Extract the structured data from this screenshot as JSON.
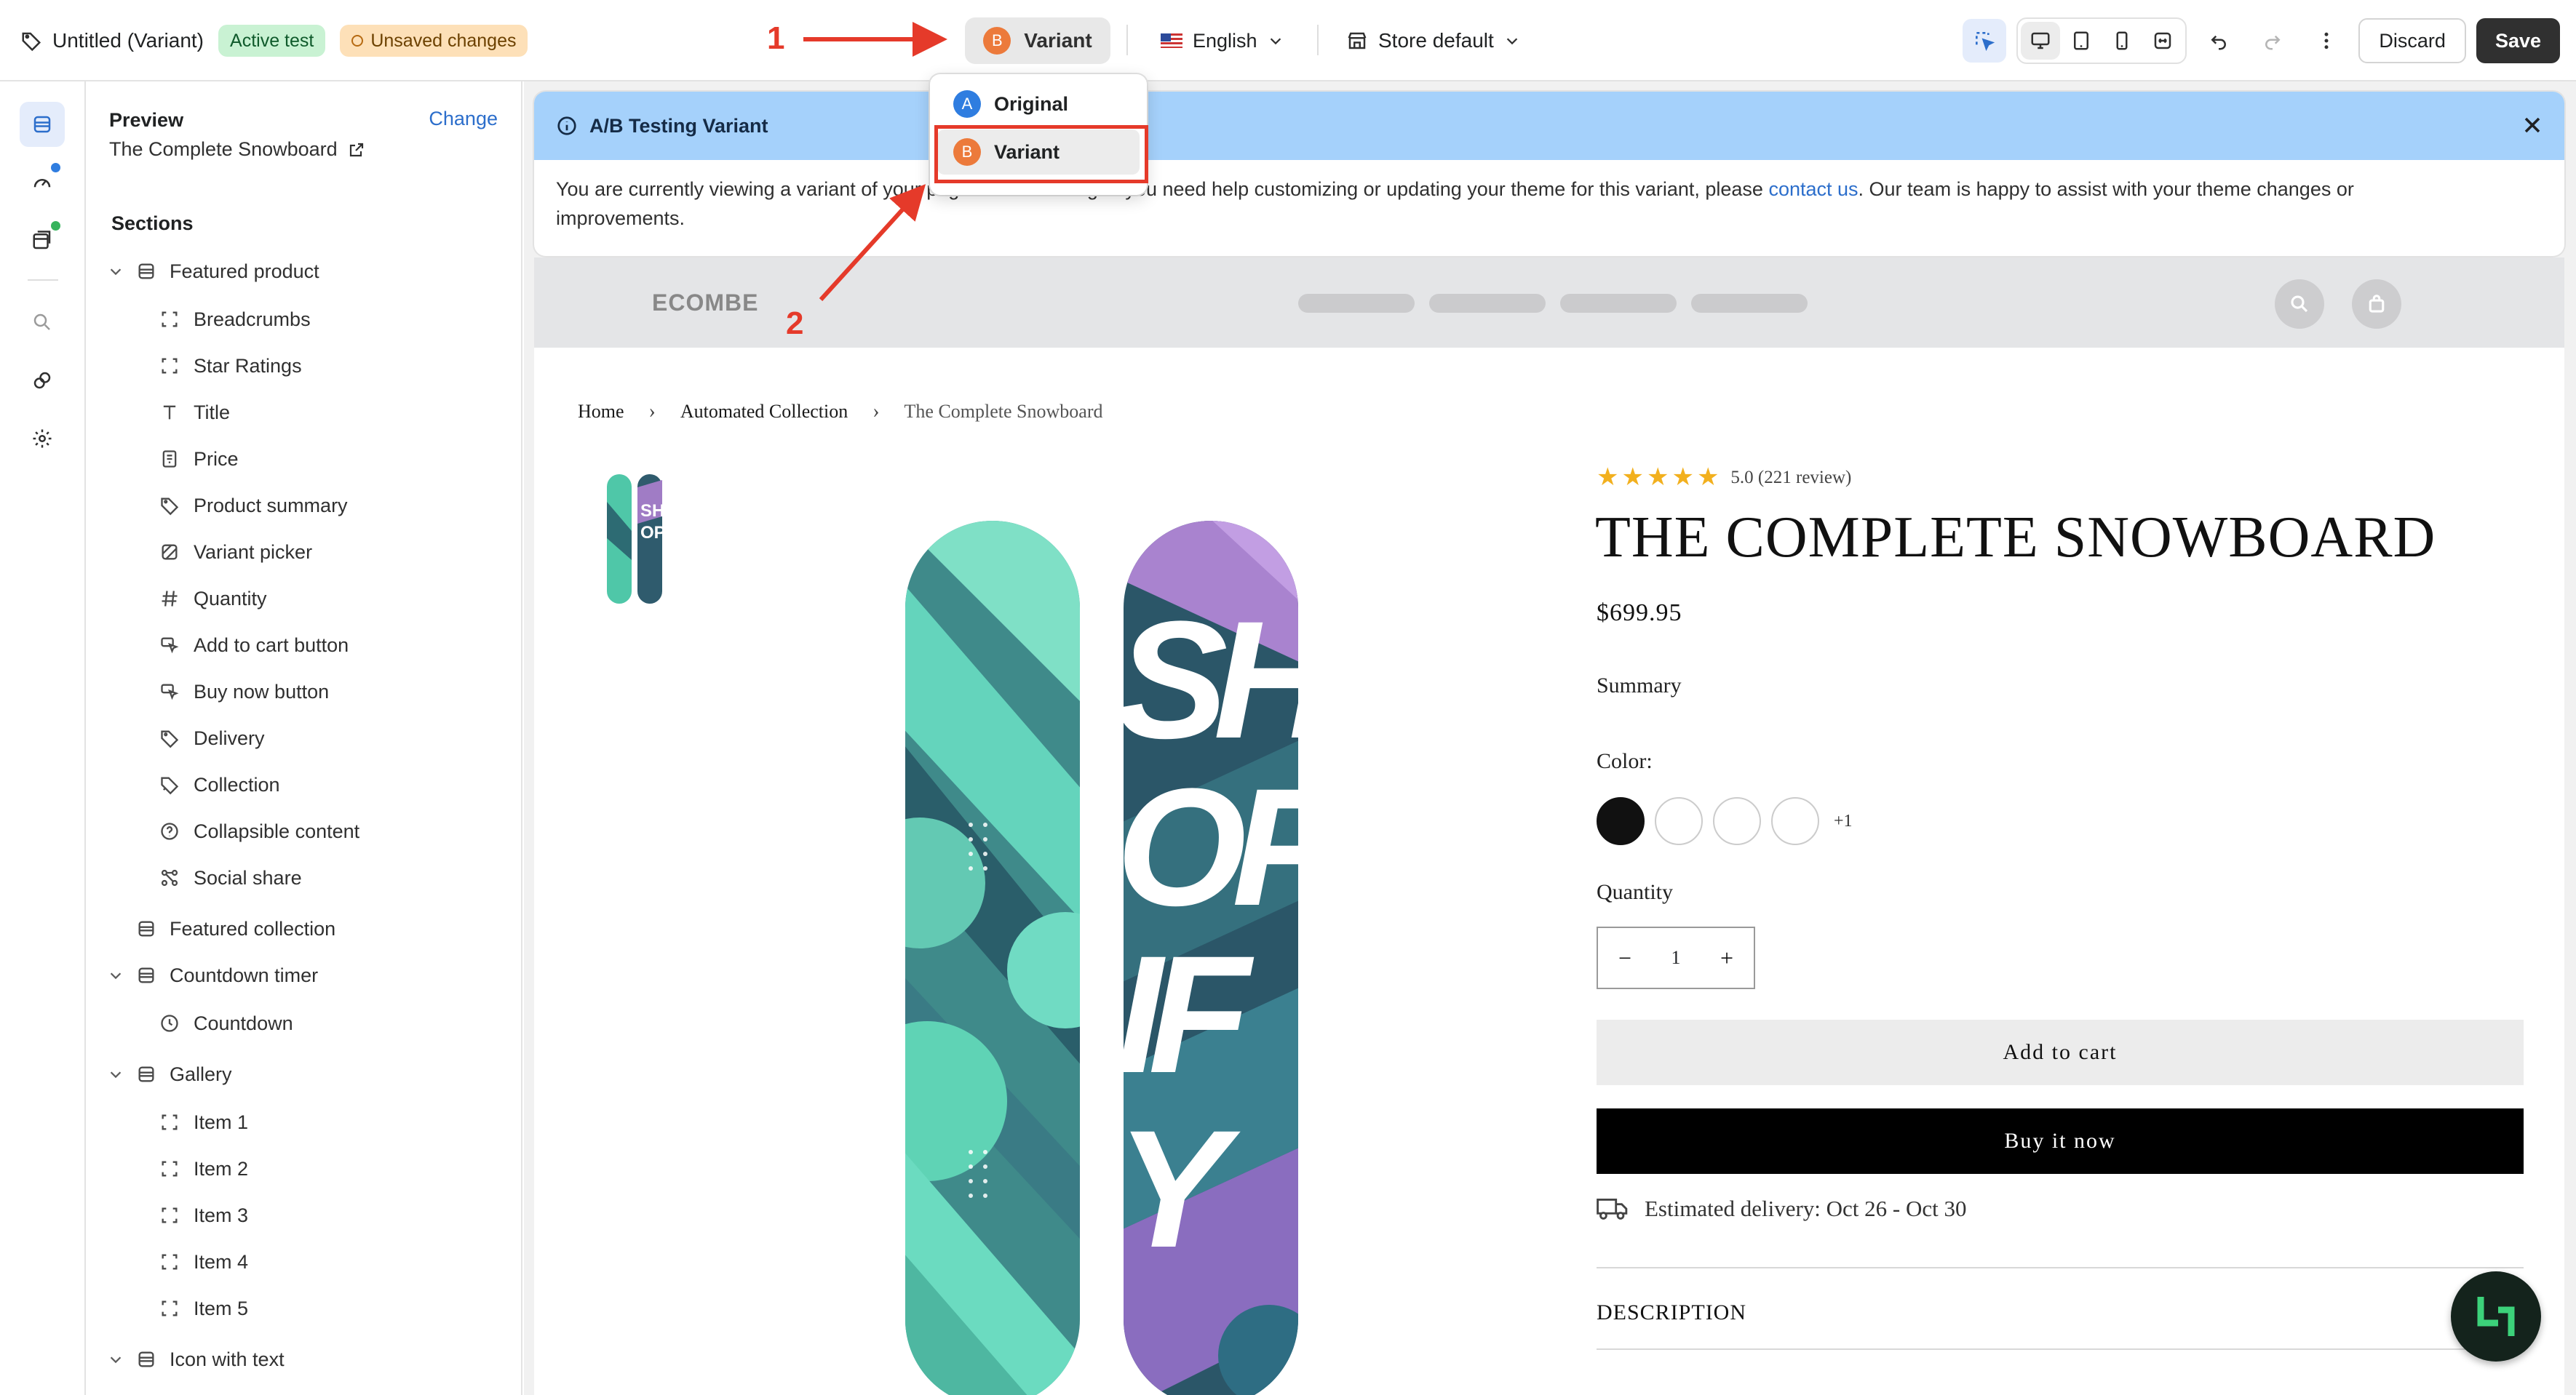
{
  "topbar": {
    "page_title": "Untitled (Variant)",
    "badge_active": "Active test",
    "badge_unsaved": "Unsaved changes",
    "variant_letter": "B",
    "variant_label": "Variant",
    "language": "English",
    "store": "Store default",
    "discard": "Discard",
    "save": "Save"
  },
  "dropdown": {
    "items": [
      {
        "letter": "A",
        "label": "Original"
      },
      {
        "letter": "B",
        "label": "Variant"
      }
    ]
  },
  "annotations": {
    "step1": "1",
    "step2": "2"
  },
  "sidebar": {
    "preview_label": "Preview",
    "preview_name": "The Complete Snowboard",
    "change": "Change",
    "sections_heading": "Sections",
    "tree": [
      {
        "label": "Featured product",
        "icon": "section-icon"
      },
      {
        "label": "Breadcrumbs",
        "icon": "block-icon"
      },
      {
        "label": "Star Ratings",
        "icon": "block-icon"
      },
      {
        "label": "Title",
        "icon": "text-icon"
      },
      {
        "label": "Price",
        "icon": "receipt-icon"
      },
      {
        "label": "Product summary",
        "icon": "tag-icon"
      },
      {
        "label": "Variant picker",
        "icon": "variant-icon"
      },
      {
        "label": "Quantity",
        "icon": "hash-icon"
      },
      {
        "label": "Add to cart button",
        "icon": "cursor-icon"
      },
      {
        "label": "Buy now button",
        "icon": "cursor-icon"
      },
      {
        "label": "Delivery",
        "icon": "tag-icon"
      },
      {
        "label": "Collection",
        "icon": "collection-icon"
      },
      {
        "label": "Collapsible content",
        "icon": "question-icon"
      },
      {
        "label": "Social share",
        "icon": "share-icon"
      },
      {
        "label": "Featured collection",
        "icon": "section-icon"
      },
      {
        "label": "Countdown timer",
        "icon": "section-icon"
      },
      {
        "label": "Countdown",
        "icon": "clock-icon"
      },
      {
        "label": "Gallery",
        "icon": "section-icon"
      },
      {
        "label": "Item 1",
        "icon": "block-icon"
      },
      {
        "label": "Item 2",
        "icon": "block-icon"
      },
      {
        "label": "Item 3",
        "icon": "block-icon"
      },
      {
        "label": "Item 4",
        "icon": "block-icon"
      },
      {
        "label": "Item 5",
        "icon": "block-icon"
      },
      {
        "label": "Icon with text",
        "icon": "section-icon"
      }
    ]
  },
  "ab_banner": {
    "title": "A/B Testing Variant",
    "text_before": "You are currently viewing a variant of your page for A/B testing. If you need help customizing or updating your theme for this variant, please ",
    "link": "contact us",
    "text_after": ". Our team is happy to assist with your theme changes or improvements."
  },
  "store": {
    "logo": "ECOMBE",
    "breadcrumbs": [
      "Home",
      "Automated Collection",
      "The Complete Snowboard"
    ],
    "rating": "5.0 (221 review)",
    "rating_stars": 5,
    "product_title": "THE COMPLETE SNOWBOARD",
    "price": "$699.95",
    "summary": "Summary",
    "color_label": "Color:",
    "more_colors": "+1",
    "quantity_label": "Quantity",
    "quantity_value": "1",
    "add_to_cart": "Add to cart",
    "buy_now": "Buy it now",
    "delivery": "Estimated delivery: Oct 26 - Oct 30",
    "description": "DESCRIPTION"
  },
  "colors": {
    "accent_blue": "#2c6ecb",
    "variant_orange": "#ec7a3b",
    "annotation_red": "#e53a2a",
    "banner_blue": "#a5d1fb"
  }
}
